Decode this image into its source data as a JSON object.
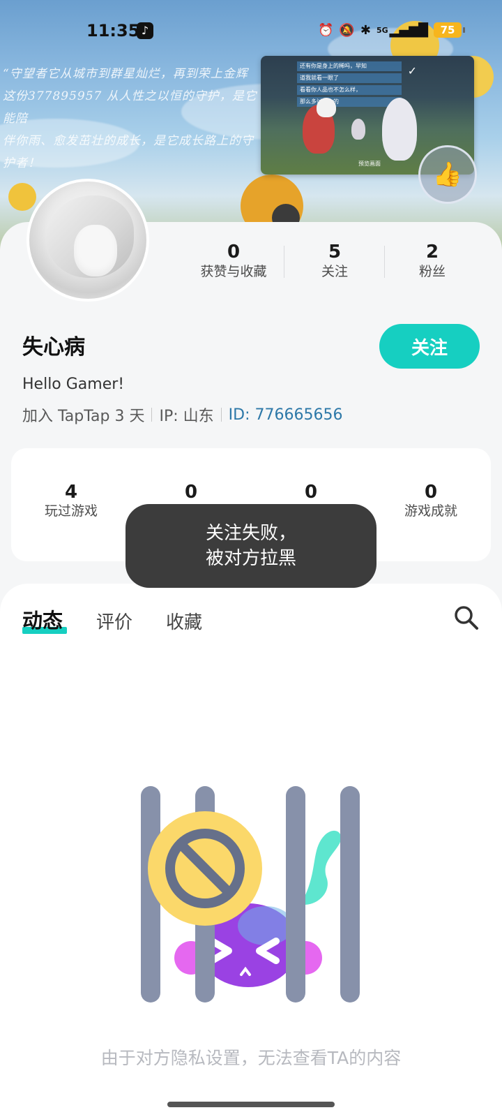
{
  "status_bar": {
    "time": "11:35",
    "network": "5G",
    "battery": "75",
    "icons": [
      "alarm-icon",
      "mute-icon",
      "bluetooth-icon",
      "signal-icon",
      "battery-icon"
    ],
    "app_icon": "tiktok-icon"
  },
  "banner": {
    "calligraphy_lines": [
      "“守望者它从城市到群星灿烂，再到荣上金辉",
      "这份377895957 从人性之以恒的守护，是它能陪",
      "伴你雨、愈发茁壮的成长，是它成长路上的守",
      "护者！"
    ],
    "pip": {
      "chat": [
        "还有你是身上的稀吗，早知",
        "道我就看一眼了",
        "看看你人品也不怎么样，",
        "那么多讨厌你的"
      ],
      "caption": "预览画面",
      "check_mark": "✓"
    },
    "thumb_icon": "thumbs-up-icon"
  },
  "profile": {
    "username": "失心病",
    "follow_label": "关注",
    "bio": "Hello Gamer!",
    "join_text": "加入 TapTap 3 天",
    "ip_text": "IP: 山东",
    "id_text": "ID: 776665656",
    "stats": [
      {
        "value": "0",
        "label": "获赞与收藏"
      },
      {
        "value": "5",
        "label": "关注"
      },
      {
        "value": "2",
        "label": "粉丝"
      }
    ]
  },
  "game_stats": [
    {
      "value": "4",
      "label": "玩过游戏"
    },
    {
      "value": "0",
      "label": ""
    },
    {
      "value": "0",
      "label": ""
    },
    {
      "value": "0",
      "label": "游戏成就"
    }
  ],
  "toast": {
    "line1": "关注失败，",
    "line2": "被对方拉黑"
  },
  "tabs": [
    {
      "label": "动态",
      "active": true
    },
    {
      "label": "评价",
      "active": false
    },
    {
      "label": "收藏",
      "active": false
    }
  ],
  "empty_state": {
    "message": "由于对方隐私设置，无法查看TA的内容",
    "icon": "blocked-icon"
  },
  "colors": {
    "accent": "#16cfc1",
    "toast_bg": "#343434",
    "id_link": "#2d78a8",
    "bar_gray": "#8791aa",
    "block_yellow": "#fbd86a",
    "creature_purple": "#9a42e3"
  }
}
